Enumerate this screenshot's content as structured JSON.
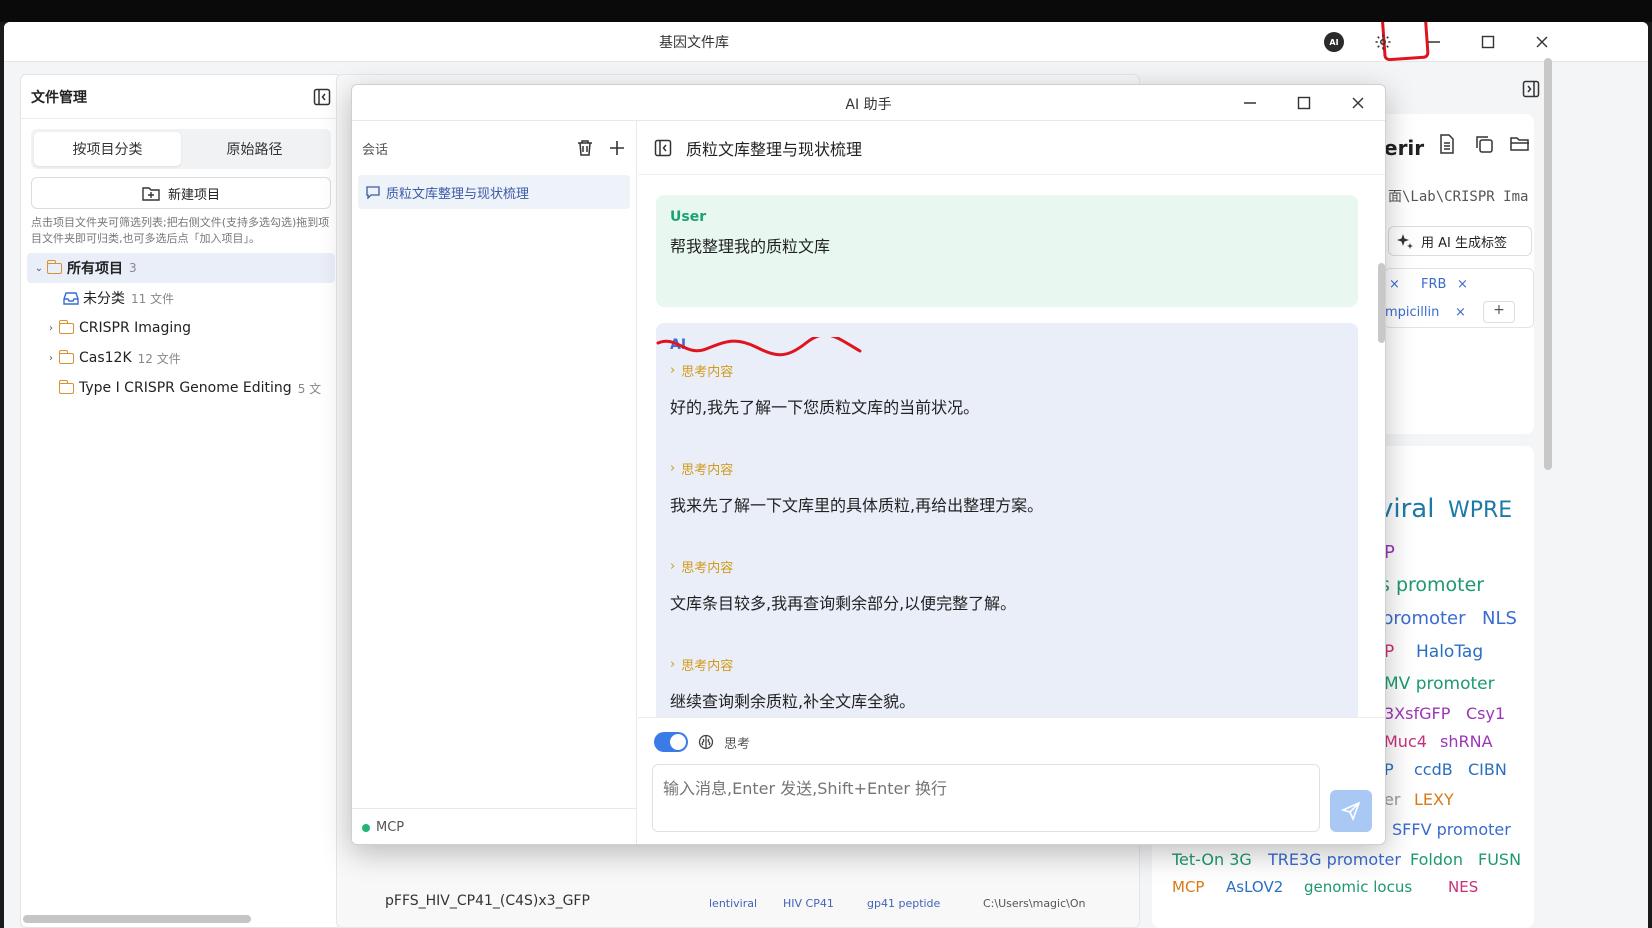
{
  "window": {
    "title": "基因文件库",
    "ai_badge": "AI"
  },
  "left_panel": {
    "title": "文件管理",
    "tabs": [
      "按项目分类",
      "原始路径"
    ],
    "new_project": "新建项目",
    "hint": "点击项目文件夹可筛选列表;把右侧文件(支持多选勾选)拖到项目文件夹即可归类,也可多选后点「加入项目」。",
    "tree": {
      "root_label": "所有项目",
      "root_count": "3",
      "items": [
        {
          "label": "未分类",
          "count": "11 文件"
        },
        {
          "label": "CRISPR Imaging",
          "count": ""
        },
        {
          "label": "Cas12K",
          "count": "12 文件"
        },
        {
          "label": "Type I CRISPR Genome Editing",
          "count": "5 文"
        }
      ]
    }
  },
  "background": {
    "bottom_row_name": "pFFS_HIV_CP41_(C4S)x3_GFP",
    "bottom_row_tags": [
      "lentiviral",
      "HIV CP41",
      "gp41 peptide"
    ],
    "bottom_row_path": "C:\\Users\\magic\\On",
    "right_partial_title": "erir",
    "right_partial_path": "面\\Lab\\CRISPR Ima",
    "ai_tag_button": "用 AI 生成标签",
    "tags": [
      "FRB",
      "mpicillin"
    ],
    "cloud_words": [
      {
        "text": "viral",
        "color": "#1d7aa8"
      },
      {
        "text": "WPRE",
        "color": "#1d7aa8"
      },
      {
        "text": "P",
        "color": "#9b36b8"
      },
      {
        "text": "s promoter",
        "color": "#1d9a6c"
      },
      {
        "text": "promoter",
        "color": "#3a6bd0"
      },
      {
        "text": "NLS",
        "color": "#3a6bd0"
      },
      {
        "text": "P",
        "color": "#c8307a"
      },
      {
        "text": "HaloTag",
        "color": "#2a6fc0"
      },
      {
        "text": "MV promoter",
        "color": "#1d9a6c"
      },
      {
        "text": "3XsfGFP",
        "color": "#9b36b8"
      },
      {
        "text": "Csy1",
        "color": "#9b36b8"
      },
      {
        "text": "Muc4",
        "color": "#c8307a"
      },
      {
        "text": "shRNA",
        "color": "#9b36b8"
      },
      {
        "text": "P",
        "color": "#2a6fc0"
      },
      {
        "text": "ccdB",
        "color": "#2a6fc0"
      },
      {
        "text": "CIBN",
        "color": "#2a6fc0"
      },
      {
        "text": "er",
        "color": "#999"
      },
      {
        "text": "LEXY",
        "color": "#d97a14"
      },
      {
        "text": "SFFV promoter",
        "color": "#3a6bd0"
      },
      {
        "text": "Tet-On 3G",
        "color": "#1d9a6c"
      },
      {
        "text": "TRE3G promoter",
        "color": "#3a6bd0"
      },
      {
        "text": "Foldon",
        "color": "#1d9a6c"
      },
      {
        "text": "FUSN",
        "color": "#1d9a6c"
      },
      {
        "text": "MCP",
        "color": "#d97a14"
      },
      {
        "text": "AsLOV2",
        "color": "#2a6fc0"
      },
      {
        "text": "genomic locus",
        "color": "#1d9a6c"
      },
      {
        "text": "NES",
        "color": "#c8307a"
      }
    ]
  },
  "dialog": {
    "title": "AI 助手",
    "sessions_label": "会话",
    "session_item": "质粒文库整理与现状梳理",
    "mcp_label": "MCP",
    "chat_title": "质粒文库整理与现状梳理",
    "user_role": "User",
    "user_message": "帮我整理我的质粒文库",
    "ai_role": "AI",
    "think_label": "思考内容",
    "ai_messages": [
      "好的,我先了解一下您质粒文库的当前状况。",
      "我来先了解一下文库里的具体质粒,再给出整理方案。",
      "文库条目较多,我再查询剩余部分,以便完整了解。",
      "继续查询剩余质粒,补全文库全貌。"
    ],
    "think_toggle_label": "思考",
    "input_placeholder": "输入消息,Enter 发送,Shift+Enter 换行"
  },
  "colors": {
    "accent": "#3b7be8",
    "annotation_red": "#e0141e",
    "user_bubble": "#e8f8f1",
    "ai_bubble": "#e9eef9"
  }
}
